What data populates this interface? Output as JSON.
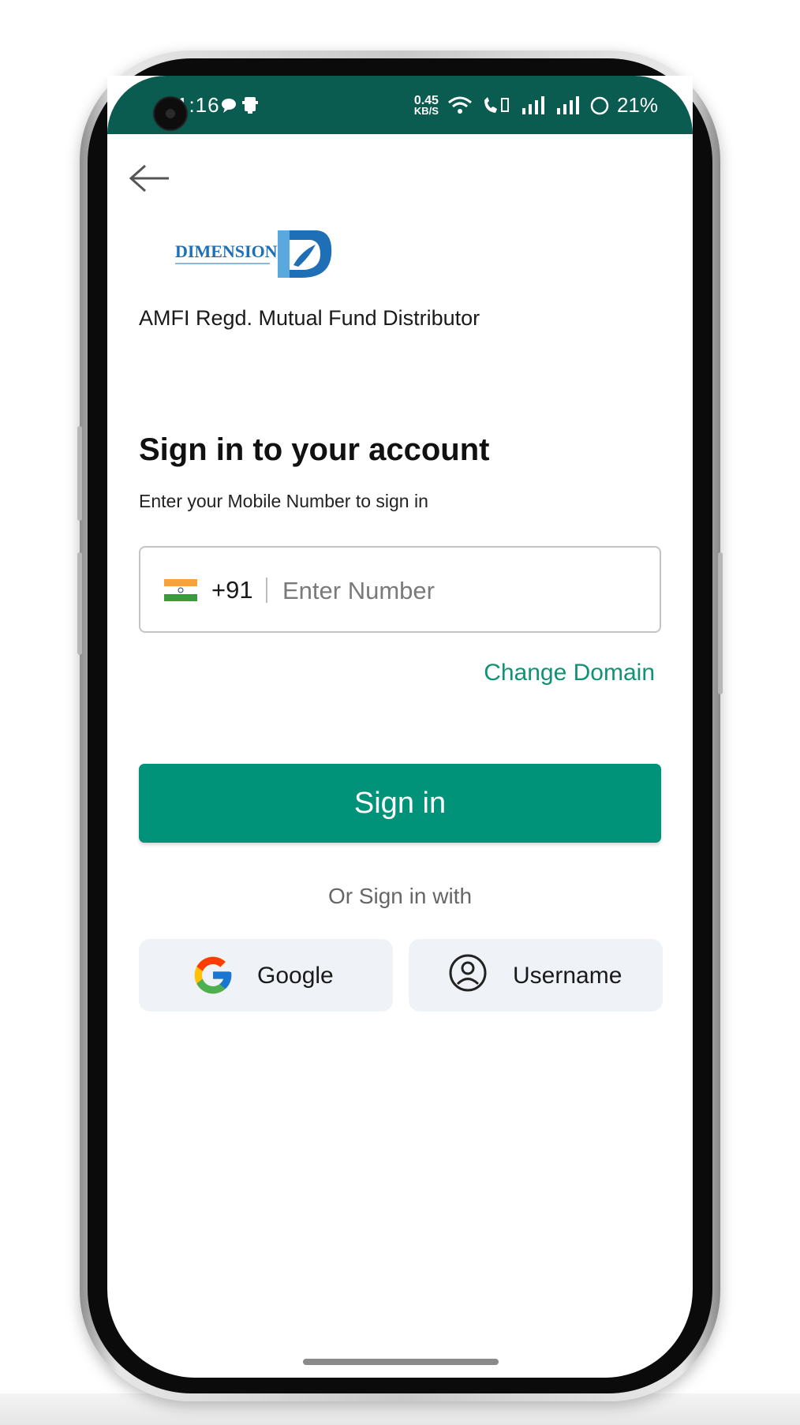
{
  "status_bar": {
    "time": "1:16",
    "network_speed": "0.45",
    "network_unit": "KB/S",
    "battery": "21%"
  },
  "brand": {
    "logo_text": "DIMENSION",
    "tagline": "AMFI Regd. Mutual Fund Distributor"
  },
  "signin": {
    "title": "Sign in to your account",
    "subtitle": "Enter your Mobile Number to sign in",
    "country_code": "+91",
    "number_placeholder": "Enter Number",
    "number_value": "",
    "change_domain_label": "Change Domain",
    "button_label": "Sign in",
    "or_label": "Or Sign in with",
    "google_label": "Google",
    "username_label": "Username"
  },
  "colors": {
    "status_bar": "#0a5c50",
    "primary": "#01927a",
    "link": "#119275",
    "alt_button_bg": "#eff3f8"
  },
  "icons": [
    "back-arrow-icon",
    "india-flag-icon",
    "google-icon",
    "user-circle-icon",
    "wifi-icon",
    "signal-icon",
    "battery-icon",
    "message-icon"
  ]
}
